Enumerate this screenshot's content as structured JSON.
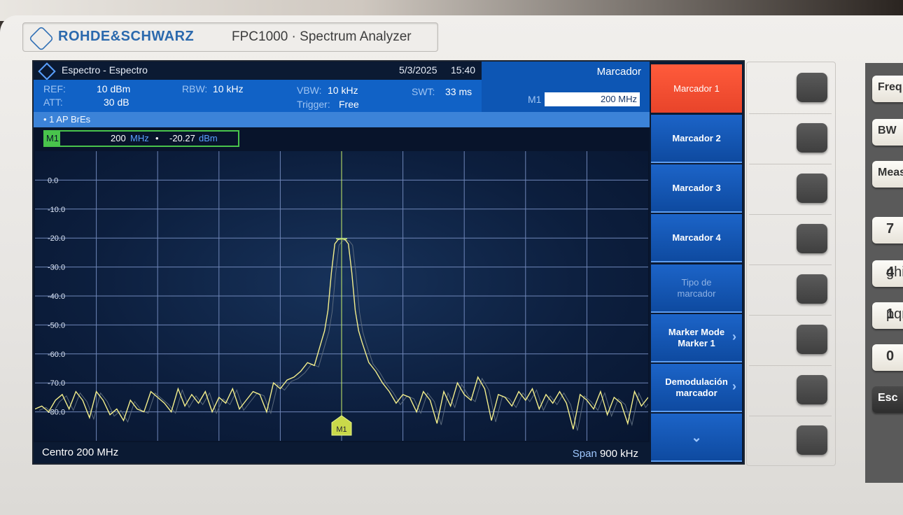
{
  "brand": {
    "name": "ROHDE&SCHWARZ",
    "model": "FPC1000 · Spectrum Analyzer"
  },
  "titlebar": {
    "title": "Espectro - Espectro",
    "date": "5/3/2025",
    "time": "15:40"
  },
  "params": {
    "ref_label": "REF:",
    "ref_value": "10 dBm",
    "att_label": "ATT:",
    "att_value": "30 dB",
    "rbw_label": "RBW:",
    "rbw_value": "10 kHz",
    "vbw_label": "VBW:",
    "vbw_value": "10 kHz",
    "trigger_label": "Trigger:",
    "trigger_value": "Free",
    "swt_label": "SWT:",
    "swt_value": "33 ms"
  },
  "trace_info": "• 1 AP  BrEs",
  "marker_panel": {
    "title": "Marcador",
    "m1_label": "M1",
    "m1_value": "200 MHz"
  },
  "marker_readout": {
    "tag": "M1",
    "freq": "200",
    "freq_unit": "MHz",
    "sep": "•",
    "level": "-20.27",
    "level_unit": "dBm"
  },
  "footer": {
    "center_label": "Centro",
    "center_value": "200 MHz",
    "span_label": "Span",
    "span_value": "900 kHz"
  },
  "softkeys": [
    {
      "label": "Marcador 1",
      "state": "active"
    },
    {
      "label": "Marcador 2",
      "state": "normal"
    },
    {
      "label": "Marcador 3",
      "state": "normal"
    },
    {
      "label": "Marcador 4",
      "state": "normal"
    },
    {
      "label": "Tipo de marcador",
      "state": "disabled"
    },
    {
      "label": "Marker Mode Marker 1",
      "state": "submenu"
    },
    {
      "label": "Demodulación marcador",
      "state": "submenu"
    },
    {
      "label": "",
      "state": "more",
      "icon": "chevron-down-icon"
    }
  ],
  "right_keys": [
    "Freq",
    "BW",
    "Meas",
    "7",
    "4",
    "1",
    "0",
    "Esc"
  ],
  "right_key_subs": {
    "4": "ghi",
    "1": "pqrs"
  },
  "colors": {
    "trace": "#f4ef8c",
    "grid": "#6f86b8",
    "marker": "#c9f06a",
    "active_softkey": "#f0502f",
    "param_bar": "#1162c6"
  },
  "chart_data": {
    "type": "line",
    "title": "",
    "xlabel": "",
    "ylabel": "",
    "x_unit": "MHz",
    "y_unit": "dBm",
    "xlim": [
      199.55,
      200.45
    ],
    "ylim": [
      -90,
      10
    ],
    "yticks": [
      "0.0",
      "-10.0",
      "-20.0",
      "-30.0",
      "-40.0",
      "-50.0",
      "-60.0",
      "-70.0",
      "-80.0"
    ],
    "grid": true,
    "series": [
      {
        "name": "",
        "x": [
          199.55,
          199.56,
          199.57,
          199.58,
          199.59,
          199.6,
          199.61,
          199.62,
          199.63,
          199.64,
          199.65,
          199.66,
          199.67,
          199.68,
          199.69,
          199.7,
          199.71,
          199.72,
          199.73,
          199.74,
          199.75,
          199.76,
          199.77,
          199.78,
          199.79,
          199.8,
          199.81,
          199.82,
          199.83,
          199.84,
          199.85,
          199.86,
          199.87,
          199.88,
          199.89,
          199.9,
          199.91,
          199.92,
          199.93,
          199.94,
          199.95,
          199.96,
          199.97,
          199.975,
          199.98,
          199.985,
          199.99,
          199.995,
          200.0,
          200.005,
          200.01,
          200.015,
          200.02,
          200.025,
          200.03,
          200.04,
          200.05,
          200.06,
          200.07,
          200.08,
          200.09,
          200.1,
          200.11,
          200.12,
          200.13,
          200.14,
          200.15,
          200.16,
          200.17,
          200.18,
          200.19,
          200.2,
          200.21,
          200.22,
          200.23,
          200.24,
          200.25,
          200.26,
          200.27,
          200.28,
          200.29,
          200.3,
          200.31,
          200.32,
          200.33,
          200.34,
          200.35,
          200.36,
          200.37,
          200.38,
          200.39,
          200.4,
          200.41,
          200.42,
          200.43,
          200.44,
          200.45
        ],
        "y": [
          -79,
          -78,
          -80,
          -76,
          -74,
          -79,
          -73,
          -76,
          -82,
          -73,
          -76,
          -81,
          -79,
          -83,
          -76,
          -79,
          -80,
          -73,
          -75,
          -77,
          -80,
          -72,
          -78,
          -74,
          -77,
          -73,
          -80,
          -75,
          -77,
          -72,
          -79,
          -76,
          -73,
          -74,
          -80,
          -70,
          -72,
          -69,
          -68,
          -66,
          -63,
          -64,
          -56,
          -52,
          -45,
          -32,
          -22,
          -20.5,
          -20.27,
          -20.5,
          -22,
          -32,
          -45,
          -52,
          -56,
          -63,
          -66,
          -70,
          -73,
          -77,
          -74,
          -75,
          -80,
          -73,
          -76,
          -84,
          -73,
          -78,
          -70,
          -74,
          -76,
          -68,
          -72,
          -83,
          -74,
          -75,
          -78,
          -73,
          -76,
          -72,
          -79,
          -74,
          -77,
          -73,
          -77,
          -86,
          -74,
          -76,
          -79,
          -73,
          -81,
          -75,
          -77,
          -84,
          -73,
          -78,
          -75
        ]
      }
    ],
    "marker": {
      "name": "M1",
      "x": 200.0,
      "y": -20.27
    }
  }
}
